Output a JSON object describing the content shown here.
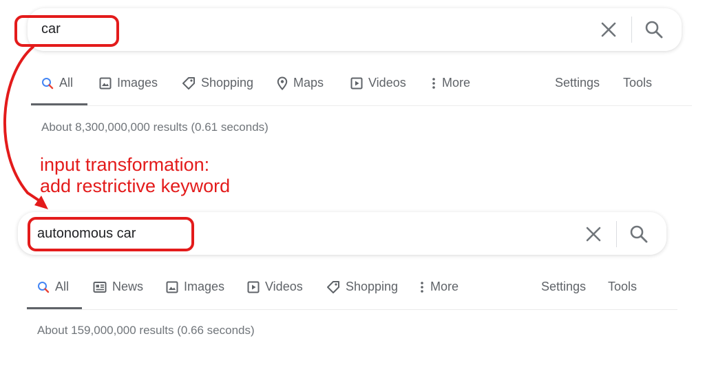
{
  "colors": {
    "annotation_red": "#e31b1b",
    "active_tab": "#5f6368",
    "stats_gray": "#70757a",
    "google_blue": "#4285f4",
    "google_red": "#ea4335"
  },
  "top": {
    "query": "car",
    "tabs": [
      {
        "label": "All",
        "icon": "search-icon",
        "active": true
      },
      {
        "label": "Images",
        "icon": "image-icon"
      },
      {
        "label": "Shopping",
        "icon": "tag-icon"
      },
      {
        "label": "Maps",
        "icon": "map-pin-icon"
      },
      {
        "label": "Videos",
        "icon": "play-icon"
      },
      {
        "label": "More",
        "icon": "more-vert-icon"
      }
    ],
    "settings_label": "Settings",
    "tools_label": "Tools",
    "result_stats": "About 8,300,000,000 results (0.61 seconds)"
  },
  "annotation": {
    "line1": "input transformation:",
    "line2": "add restrictive keyword"
  },
  "bottom": {
    "query": "autonomous car",
    "tabs": [
      {
        "label": "All",
        "icon": "search-icon",
        "active": true
      },
      {
        "label": "News",
        "icon": "news-icon"
      },
      {
        "label": "Images",
        "icon": "image-icon"
      },
      {
        "label": "Videos",
        "icon": "play-icon"
      },
      {
        "label": "Shopping",
        "icon": "tag-icon"
      },
      {
        "label": "More",
        "icon": "more-vert-icon"
      }
    ],
    "settings_label": "Settings",
    "tools_label": "Tools",
    "result_stats": "About 159,000,000 results (0.66 seconds)"
  }
}
